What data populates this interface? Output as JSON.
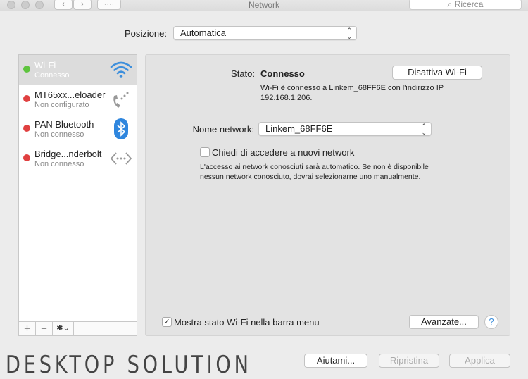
{
  "window": {
    "title": "Network",
    "search_placeholder": "Ricerca",
    "grid_label": "····"
  },
  "location": {
    "label": "Posizione:",
    "value": "Automatica"
  },
  "services": [
    {
      "name": "Wi-Fi",
      "status": "Connesso",
      "status_color": "#5ec43e",
      "icon": "wifi-icon",
      "selected": true
    },
    {
      "name": "MT65xx...eloader",
      "status": "Non configurato",
      "status_color": "#e04040",
      "icon": "phone-icon"
    },
    {
      "name": "PAN Bluetooth",
      "status": "Non connesso",
      "status_color": "#e04040",
      "icon": "bluetooth-icon"
    },
    {
      "name": "Bridge...nderbolt",
      "status": "Non connesso",
      "status_color": "#e04040",
      "icon": "thunderbolt-bridge-icon"
    }
  ],
  "sidebar_buttons": {
    "add": "+",
    "remove": "−",
    "gear": "✱⌄"
  },
  "detail": {
    "status_label": "Stato:",
    "status_value": "Connesso",
    "toggle_button": "Disattiva Wi-Fi",
    "status_info_1": "Wi-Fi è connesso a Linkem_68FF6E con l'indirizzo IP",
    "status_info_2": "192.168.1.206.",
    "network_label": "Nome network:",
    "network_value": "Linkem_68FF6E",
    "ask_label": "Chiedi di accedere a nuovi network",
    "ask_checked": false,
    "ask_info_1": "L'accesso ai network conosciuti sarà automatico. Se non è disponibile",
    "ask_info_2": "nessun network conosciuto, dovrai selezionarne uno manualmente.",
    "menu_label": "Mostra stato Wi-Fi nella barra menu",
    "menu_checked": true,
    "advanced_button": "Avanzate...",
    "help": "?"
  },
  "footer": {
    "help_button": "Aiutami...",
    "revert_button": "Ripristina",
    "apply_button": "Applica"
  },
  "watermark": "DESKTOP SOLUTION"
}
